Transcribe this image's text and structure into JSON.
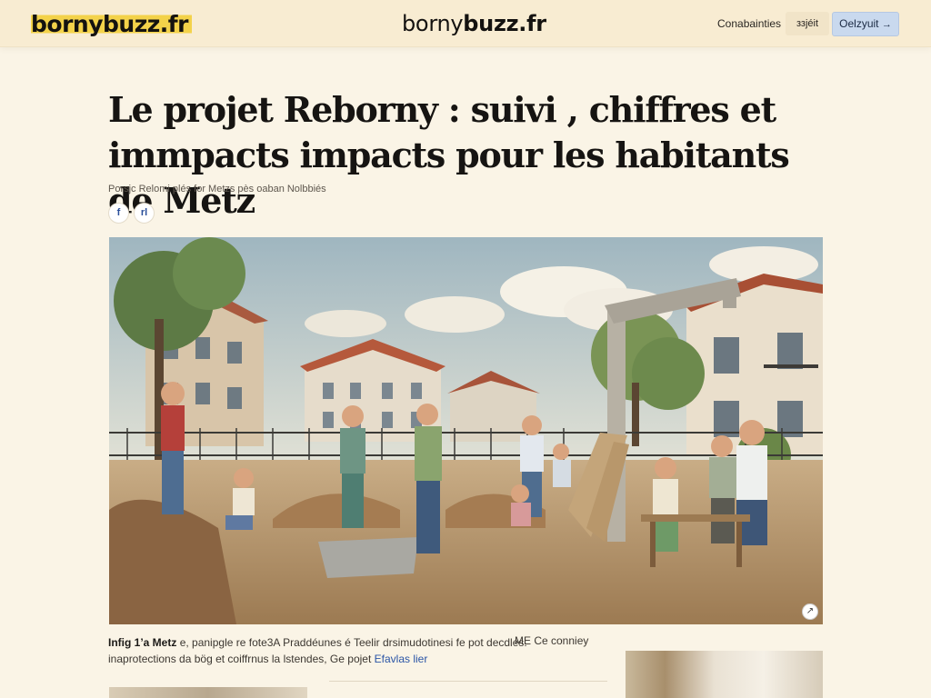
{
  "header": {
    "logo_left": "bornybuzz.fr",
    "logo_center_light": "borny",
    "logo_center_bold": "buzz.fr",
    "nav_link": "Conabainties",
    "search_btn": "ззjéit",
    "cta_btn": "Oelzyuit",
    "cta_icon": "arrow-icon"
  },
  "article": {
    "headline": "Le projet Reborny : suivi , chiffres et immpacts impacts pour les habitants de Metz",
    "byline": "Porsjc Relomi plés for Metzs pès oaban Nolbbiés",
    "share_facebook": "f",
    "share_other": "rl",
    "caption_lead": "Infig 1’a Metz",
    "caption_body": "e, panipgle re fote3A Praddéunes é Teelir drsimudotinesi fe pot decdles.",
    "caption_line2": "inaprotections da bög et coiffrnus la lstendes, Ge pojet",
    "caption_link": "Efavlas lier",
    "caption_tail": "ME Ce conniey",
    "expand_icon": "expand-icon"
  },
  "colors": {
    "page_bg": "#faf4e6",
    "header_bg": "#f8ecd2",
    "logo_highlight": "#f3d24a",
    "cta_bg": "#c9d9ee",
    "link": "#2b55a6"
  }
}
